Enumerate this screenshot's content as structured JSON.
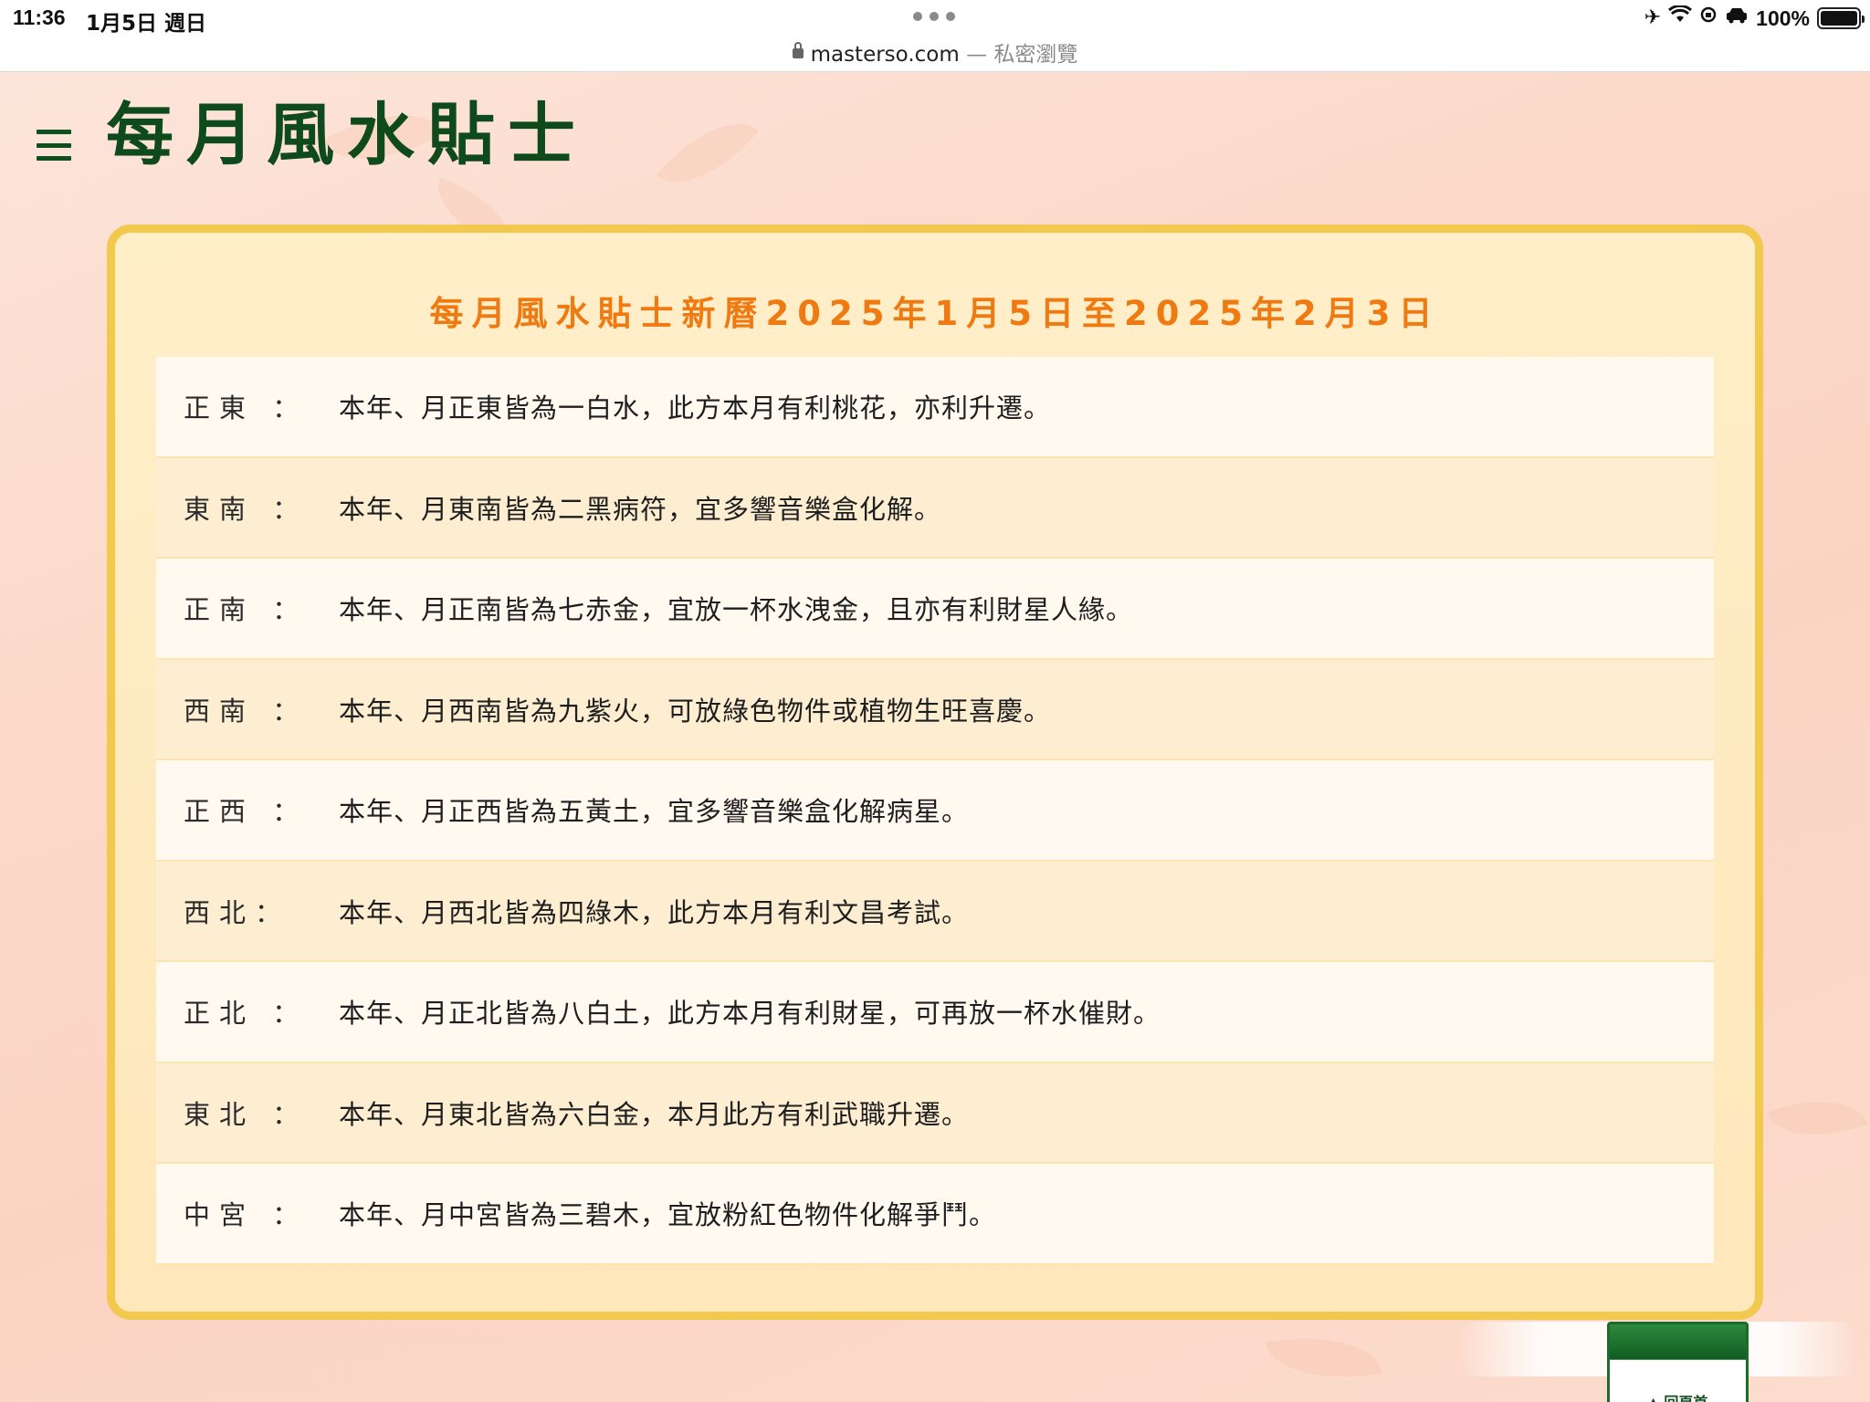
{
  "status_bar": {
    "time": "11:36",
    "date": "1月5日 週日",
    "battery": "100%",
    "battery_level": 1.0
  },
  "browser": {
    "domain": "masterso.com",
    "mode": " — 私密瀏覽"
  },
  "header": {
    "title": "每月風水貼士"
  },
  "card": {
    "title": "每月風水貼士新曆2025年1月5日至2025年2月3日",
    "rows": [
      {
        "direction": "正東 ：",
        "tip": "本年、月正東皆為一白水，此方本月有利桃花，亦利升遷。"
      },
      {
        "direction": "東南 ：",
        "tip": "本年、月東南皆為二黑病符，宜多響音樂盒化解。"
      },
      {
        "direction": "正南 ：",
        "tip": "本年、月正南皆為七赤金，宜放一杯水洩金，且亦有利財星人緣。"
      },
      {
        "direction": "西南 ：",
        "tip": "本年、月西南皆為九紫火，可放綠色物件或植物生旺喜慶。"
      },
      {
        "direction": "正西 ：",
        "tip": "本年、月正西皆為五黃土，宜多響音樂盒化解病星。"
      },
      {
        "direction": "西北：",
        "tip": "本年、月西北皆為四綠木，此方本月有利文昌考試。"
      },
      {
        "direction": "正北 ：",
        "tip": "本年、月正北皆為八白土，此方本月有利財星，可再放一杯水催財。"
      },
      {
        "direction": "東北 ：",
        "tip": "本年、月東北皆為六白金，本月此方有利武職升遷。"
      },
      {
        "direction": "中宮 ：",
        "tip": "本年、月中宮皆為三碧木，宜放粉紅色物件化解爭鬥。"
      }
    ]
  },
  "back_to_top": {
    "label": "回頁首"
  },
  "colors": {
    "title_green": "#0f4a1c",
    "card_border": "#f2c94c",
    "card_title_orange": "#f07a12"
  },
  "icons": [
    "lock-icon",
    "airplane-icon",
    "wifi-icon",
    "orientation-lock-icon",
    "car-icon",
    "battery-icon",
    "menu-icon",
    "more-dots-icon"
  ]
}
